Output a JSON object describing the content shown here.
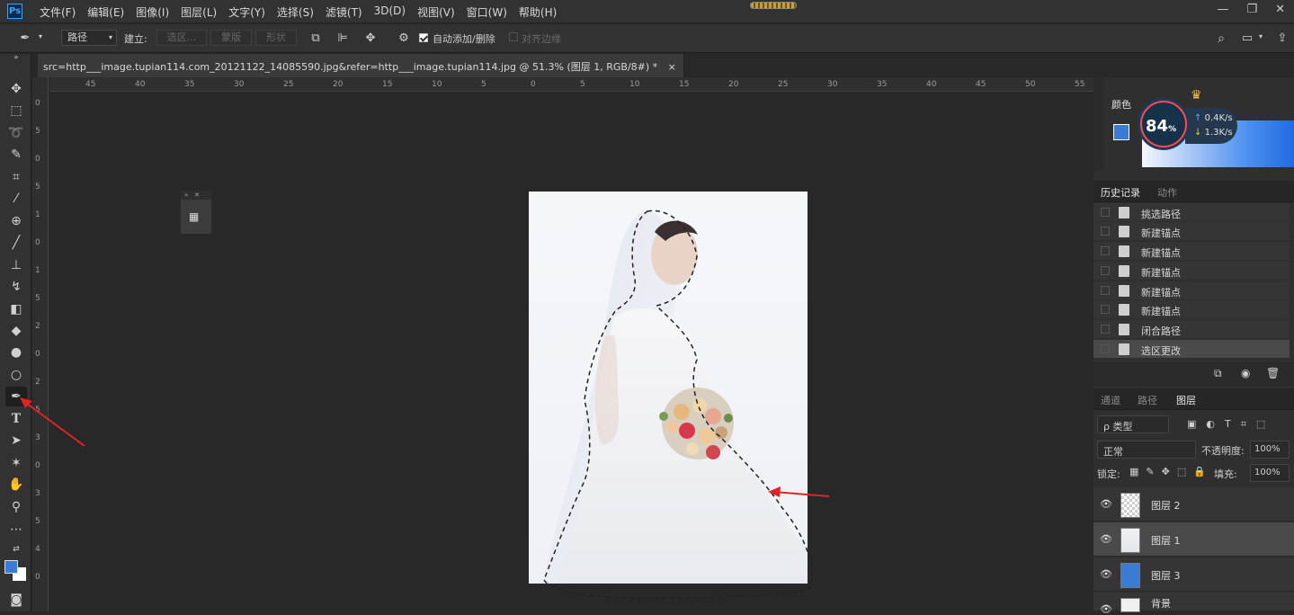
{
  "app": {
    "logo": "Ps"
  },
  "menu": [
    "文件(F)",
    "编辑(E)",
    "图像(I)",
    "图层(L)",
    "文字(Y)",
    "选择(S)",
    "滤镜(T)",
    "3D(D)",
    "视图(V)",
    "窗口(W)",
    "帮助(H)"
  ],
  "window_controls": {
    "minimize": "—",
    "restore": "❐",
    "close": "✕"
  },
  "options": {
    "tool_mode": "路径",
    "make_label": "建立:",
    "selection_btn": "选区...",
    "mask_btn": "蒙版",
    "shape_btn": "形状",
    "auto_add_delete": "自动添加/删除",
    "auto_add_delete_checked": true,
    "align_edges": "对齐边缘"
  },
  "document": {
    "tab_title": "src=http___image.tupian114.com_20121122_14085590.jpg&refer=http___image.tupian114.jpg @ 51.3% (图层 1, RGB/8#) *",
    "close": "×"
  },
  "ruler": {
    "h_ticks": [
      "45",
      "40",
      "35",
      "30",
      "25",
      "20",
      "15",
      "10",
      "5",
      "0",
      "5",
      "10",
      "15",
      "20",
      "25",
      "30",
      "35",
      "40",
      "45",
      "50",
      "55"
    ],
    "v_ticks": [
      "0",
      "5",
      "0",
      "5",
      "1",
      "0",
      "1",
      "5",
      "2",
      "0",
      "2",
      "5",
      "3",
      "0",
      "3",
      "5",
      "4",
      "0"
    ]
  },
  "panels": {
    "color": {
      "tab": "颜色"
    },
    "speed_widget": {
      "percent": "84",
      "percent_unit": "%",
      "up": "0.4K/s",
      "down": "1.3K/s"
    },
    "history": {
      "tabs": [
        "历史记录",
        "动作"
      ],
      "items": [
        {
          "label": "挑选路径",
          "selected": false
        },
        {
          "label": "新建锚点",
          "selected": false
        },
        {
          "label": "新建锚点",
          "selected": false
        },
        {
          "label": "新建锚点",
          "selected": false
        },
        {
          "label": "新建锚点",
          "selected": false
        },
        {
          "label": "新建锚点",
          "selected": false
        },
        {
          "label": "闭合路径",
          "selected": false
        },
        {
          "label": "选区更改",
          "selected": true
        }
      ]
    },
    "layers": {
      "tabs": [
        "通道",
        "路径",
        "图层"
      ],
      "filter_type": "ρ 类型",
      "blend_mode": "正常",
      "opacity_label": "不透明度:",
      "opacity": "100%",
      "lock_label": "锁定:",
      "fill_label": "填充:",
      "fill": "100%",
      "layers": [
        {
          "name": "图层 2",
          "selected": false,
          "thumb": "transparent"
        },
        {
          "name": "图层 1",
          "selected": true,
          "thumb": "photo"
        },
        {
          "name": "图层 3",
          "selected": false,
          "thumb": "#3a7bd5"
        },
        {
          "name": "背景",
          "selected": false,
          "thumb": "photo"
        }
      ]
    }
  },
  "colors": {
    "foreground": "#3a7bd5",
    "background": "#ffffff",
    "accent": "#31a8ff",
    "arrow": "#e02424"
  }
}
